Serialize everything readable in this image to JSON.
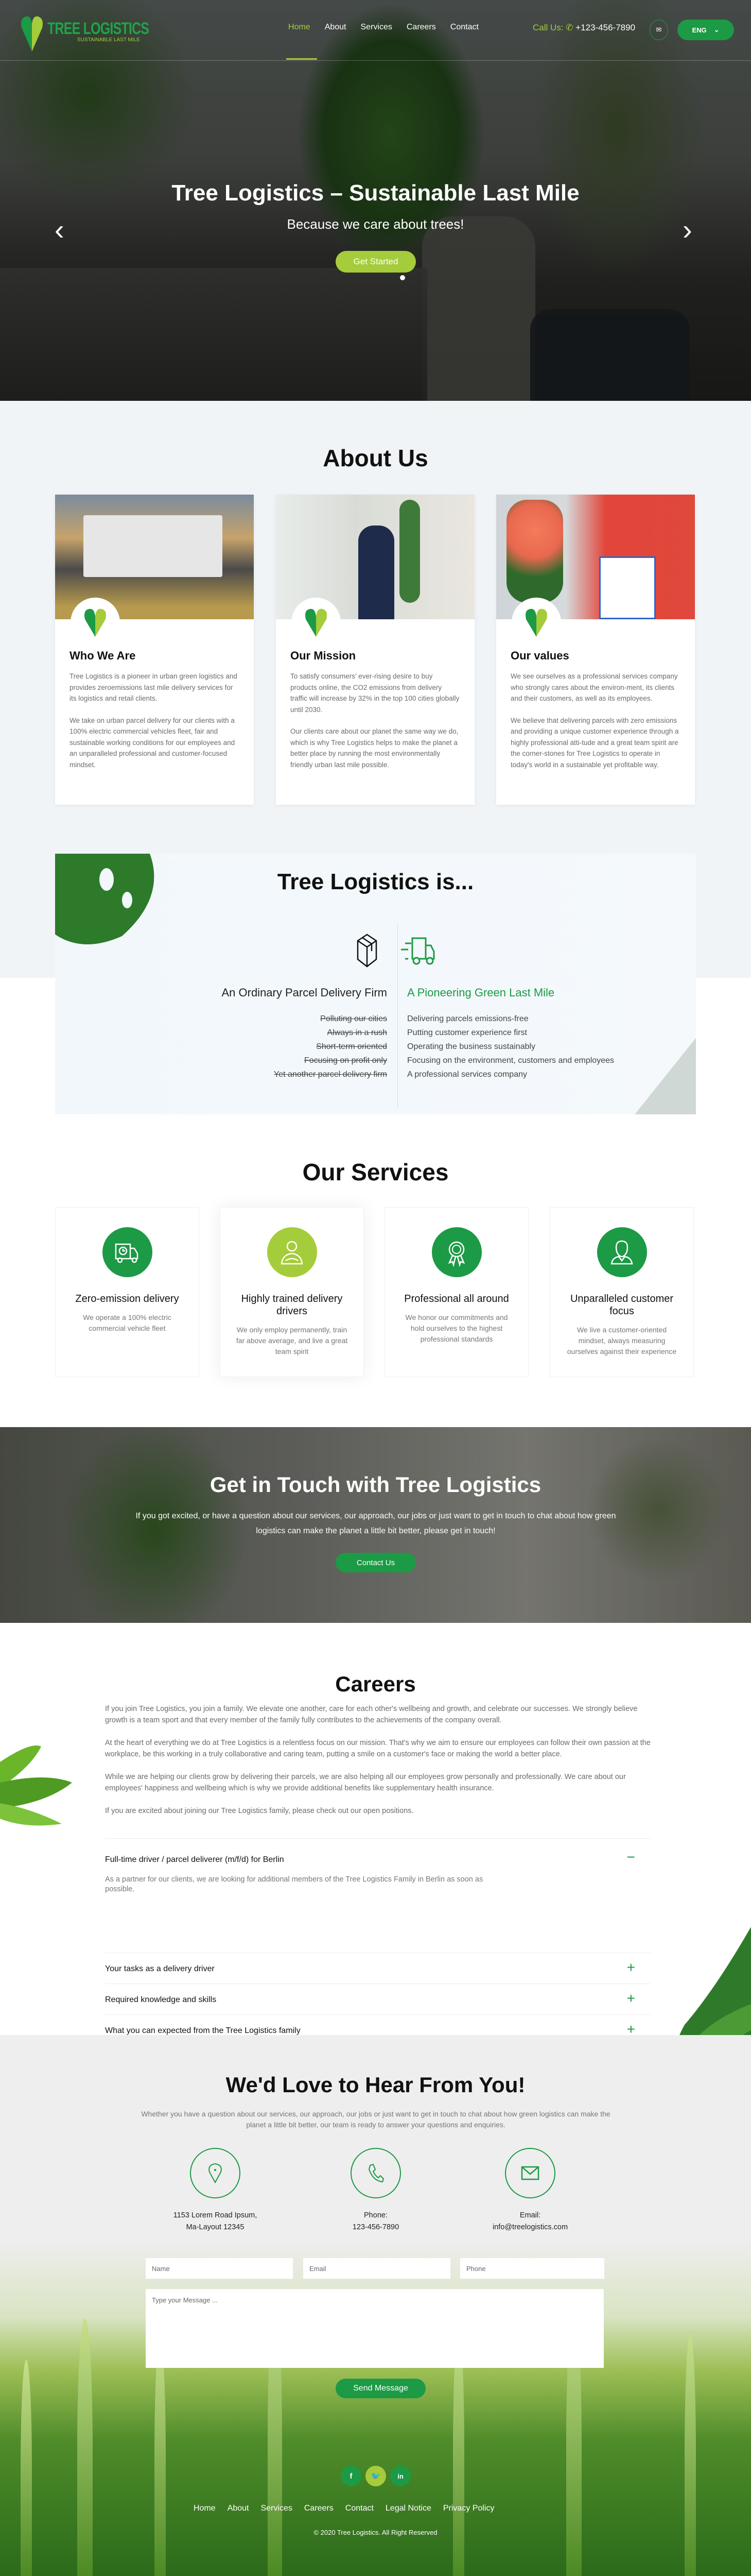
{
  "brand": {
    "name": "TREE LOGISTICS",
    "tagline": "SUSTAINABLE LAST MILE"
  },
  "colors": {
    "green": "#1c9a45",
    "lime": "#a5cc3a"
  },
  "nav": {
    "items": [
      "Home",
      "About",
      "Services",
      "Careers",
      "Contact"
    ],
    "active": "Home"
  },
  "header": {
    "call_label": "Call Us:",
    "phone": "+123-456-7890",
    "mail_icon": "mail-icon",
    "lang": "ENG"
  },
  "hero": {
    "title": "Tree Logistics – Sustainable Last Mile",
    "subtitle": "Because we care about trees!",
    "cta": "Get Started",
    "prev": "‹",
    "next": "›"
  },
  "about": {
    "title": "About Us",
    "cards": [
      {
        "title": "Who We Are",
        "paragraphs": [
          "Tree Logistics is a pioneer in urban green logistics and provides zeroemissions last mile delivery services for its logistics and retail clients.",
          "We take on urban parcel delivery for our clients with a 100% electric commercial vehicles fleet, fair and sustainable working conditions for our employees and an unparalleled professional and customer-focused mindset."
        ]
      },
      {
        "title": "Our Mission",
        "paragraphs": [
          "To satisfy consumers’ ever-rising desire to buy products online, the CO2 emissions from delivery traffic will increase by 32% in the top 100 cities globally until 2030.",
          "Our clients care about our planet the same way we do, which is why Tree Logistics helps to make the planet a better place by running the most environmentally friendly urban last mile possible."
        ]
      },
      {
        "title": "Our values",
        "paragraphs": [
          "We see ourselves as a professional services company who strongly cares about the environ-ment, its clients and their customers, as well as its employees.",
          "We believe that delivering parcels with zero emissions and providing a unique customer experience through a highly professional atti-tude and a great team spirit are the corner-stones for Tree Logistics to operate in today's world in a sustainable yet profitable way."
        ]
      }
    ]
  },
  "is": {
    "title": "Tree Logistics is...",
    "left": {
      "heading": "An Ordinary Parcel Delivery Firm",
      "items": [
        "Polluting our cities",
        "Always in a rush",
        "Short-term oriented",
        "Focusing on profit only",
        "Yet another parcel delivery firm"
      ]
    },
    "right": {
      "heading": "A Pioneering Green Last Mile",
      "items": [
        "Delivering parcels emissions-free",
        "Putting customer experience first",
        "Operating the business sustainably",
        "Focusing on the environment, customers and employees",
        "A professional services company"
      ]
    }
  },
  "services": {
    "title": "Our Services",
    "items": [
      {
        "title": "Zero-emission delivery",
        "text": "We operate a 100% electric commercial vehicle fleet",
        "icon": "delivery-truck-icon"
      },
      {
        "title": "Highly trained delivery drivers",
        "text": "We only employ permanently, train far above average, and live a great team spirit",
        "icon": "driver-icon"
      },
      {
        "title": "Professional all around",
        "text": "We honor our commitments and hold ourselves to the highest professional standards",
        "icon": "award-ribbon-icon"
      },
      {
        "title": "Unparalleled customer focus",
        "text": "We live a customer-oriented mindset, always measuring ourselves against their experience",
        "icon": "customer-icon"
      }
    ]
  },
  "touch": {
    "title": "Get in Touch with Tree Logistics",
    "text": "If you got excited, or have a question about our services, our approach, our jobs or just want to get in touch to chat about how green logistics can make the planet a little bit better, please get in touch!",
    "cta": "Contact Us"
  },
  "careers": {
    "title": "Careers",
    "paragraphs": [
      "If you join Tree Logistics, you join a family. We elevate one another, care for each other's wellbeing and growth, and celebrate our successes. We strongly believe growth is a team sport and that every member of the family fully contributes to the achievements of the company overall.",
      "At the heart of everything we do at Tree Logistics is a relentless focus on our mission. That's why we aim to ensure our employees can follow their own passion at the workplace, be this working in a truly collaborative and caring team, putting a smile on a customer's face or making the world a better place.",
      "While we are helping our clients grow by delivering their parcels, we are also helping all our employees grow personally and professionally. We care about our employees' happiness and wellbeing which is why we provide additional benefits like supplementary health insurance.",
      "If you are excited about joining our Tree Logistics family, please check out our open positions."
    ],
    "accordion": [
      {
        "title": "Full-time driver / parcel deliverer (m/f/d) for Berlin",
        "body": "As a partner for our clients, we are looking for additional members of the Tree Logistics Family in Berlin as soon as possible.",
        "icon": "−",
        "expanded": true
      },
      {
        "title": "Your tasks as a delivery driver",
        "icon": "+",
        "expanded": false
      },
      {
        "title": "Required knowledge and skills",
        "icon": "+",
        "expanded": false
      },
      {
        "title": "What you can expected from the Tree Logistics family",
        "icon": "+",
        "expanded": false
      }
    ]
  },
  "contact": {
    "title": "We'd Love to Hear From You!",
    "text": "Whether you have a question about our services, our approach, our jobs or just want to get in touch to chat about how green logistics can make the planet a little bit better, our team is ready to answer your questions and enquiries.",
    "info": [
      {
        "icon": "location-pin-icon",
        "lines": [
          "1153 Lorem Road Ipsum,",
          "Ma-Layout 12345"
        ]
      },
      {
        "icon": "phone-icon",
        "lines": [
          "Phone:",
          "123-456-7890"
        ]
      },
      {
        "icon": "envelope-icon",
        "lines": [
          "Email:",
          "info@treelogistics.com"
        ]
      }
    ],
    "form": {
      "name_placeholder": "Name",
      "email_placeholder": "Email",
      "phone_placeholder": "Phone",
      "message_placeholder": "Type your Message ...",
      "submit": "Send Message"
    }
  },
  "footer": {
    "social": [
      {
        "name": "facebook",
        "glyph": "f"
      },
      {
        "name": "twitter",
        "glyph": "t"
      },
      {
        "name": "linkedin",
        "glyph": "in"
      }
    ],
    "links": [
      "Home",
      "About",
      "Services",
      "Careers",
      "Contact",
      "Legal Notice",
      "Privacy Policy"
    ],
    "copyright": "© 2020 Tree Logistics.  All Right Reserved"
  }
}
